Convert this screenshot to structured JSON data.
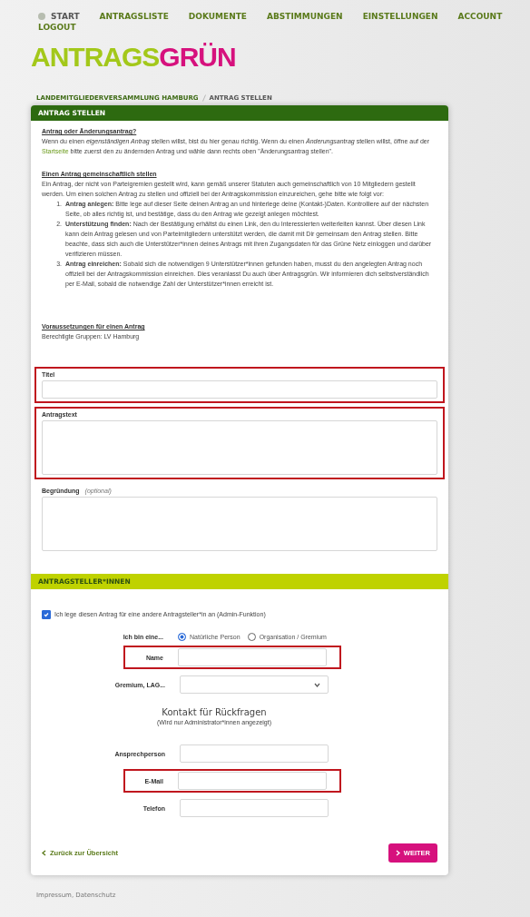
{
  "nav": [
    {
      "label": "START",
      "kind": "home"
    },
    {
      "label": "ANTRAGSLISTE",
      "kind": "link"
    },
    {
      "label": "DOKUMENTE",
      "kind": "link"
    },
    {
      "label": "ABSTIMMUNGEN",
      "kind": "link"
    },
    {
      "label": "EINSTELLUNGEN",
      "kind": "link"
    },
    {
      "label": "ACCOUNT",
      "kind": "link"
    },
    {
      "label": "LOGOUT",
      "kind": "link"
    }
  ],
  "logo": {
    "part_1": "ANTRAGS",
    "part_2": "GRÜN"
  },
  "breadcrumb": [
    "LANDEMITGLIEDERVERSAMMLUNG HAMBURG",
    "ANTRAG STELLEN"
  ],
  "card": {
    "title": "ANTRAG STELLEN",
    "intro": [
      {
        "heading": "Antrag oder Änderungsantrag?",
        "parts": [
          {
            "kind": "text",
            "text": "Wenn du einen *eigenständigen Antrag* stellen willst, bist du hier genau richtig. Wenn du einen *Änderungsantrag* stellen willst, öffne auf der "
          },
          {
            "kind": "link",
            "text": "Startseite"
          },
          {
            "kind": "text",
            "text": " bitte zuerst den zu ändernden Antrag und wähle dann rechts oben \"Änderungsantrag stellen\"."
          }
        ]
      },
      {
        "heading": "Einen Antrag gemeinschaftlich stellen",
        "parts": [
          {
            "kind": "text",
            "text": "Ein Antrag, der nicht von Parteigremien gestellt wird, kann gemäß unserer Statuten auch gemeinschaftlich von 10 Mitgliedern gestellt werden. Um einen solchen Antrag zu stellen und offiziell bei der Antragskommission einzureichen, gehe bitte wie folgt vor:"
          }
        ],
        "steps": [
          {
            "number": "1.",
            "text": "**Antrag anlegen:** Bitte lege auf dieser Seite deinen Antrag an und hinterlege deine (Kontakt-)Daten. Kontrolliere auf der nächsten Seite, ob alles richtig ist, und bestätige, dass du den Antrag wie gezeigt anlegen möchtest."
          },
          {
            "number": "2.",
            "text": "**Unterstützung finden:** Nach der Bestätigung erhältst du einen Link, den du Interessierten weiterleiten kannst. Über diesen Link kann dein Antrag gelesen und von Parteimitgliedern unterstützt werden, die damit mit Dir gemeinsam den Antrag stellen. Bitte beachte, dass sich auch die Unterstützer*innen deines Antrags mit ihren Zugangsdaten für das Grüne Netz einloggen und darüber verifizieren müssen."
          },
          {
            "number": "3.",
            "text": "**Antrag einreichen:** Sobald sich die notwendigen 9 Unterstützer*innen gefunden haben, musst du den angelegten Antrag noch offiziell bei der Antragskommission einreichen. Dies veranlasst Du auch über Antragsgrün. Wir informieren dich selbstverständlich per E-Mail, sobald die notwendige Zahl der Unterstützer*innen erreicht ist."
          }
        ]
      }
    ],
    "requirements": {
      "heading": "Voraussetzungen für einen Antrag",
      "text": "Berechtigte Gruppen: LV Hamburg"
    },
    "fields": [
      {
        "label": "Titel",
        "kind": "input",
        "highlighted": true
      },
      {
        "label": "Antragstext",
        "kind": "textarea",
        "highlighted": true
      },
      {
        "label": "Begründung",
        "hint": "(optional)",
        "kind": "textarea",
        "highlighted": false
      }
    ],
    "section": {
      "title": "ANTRAGSTELLER*INNEN",
      "admin_checkbox": {
        "label": "Ich lege diesen Antrag für eine andere Antragsteller*in an",
        "hint": "(Admin-Funktion)",
        "checked": true
      },
      "person_type": {
        "label": "Ich bin eine...",
        "options": [
          {
            "label": "Natürliche Person",
            "selected": true
          },
          {
            "label": "Organisation / Gremium",
            "selected": false
          }
        ]
      },
      "rows": [
        {
          "label": "Name",
          "kind": "input",
          "highlighted": true
        },
        {
          "label": "Gremium, LAG...",
          "kind": "select",
          "highlighted": false
        }
      ],
      "contact_heading": "Kontakt für Rückfragen",
      "contact_note": "(Wird nur Administrator*innen angezeigt)",
      "contact_rows": [
        {
          "label": "Ansprechperson",
          "kind": "input",
          "highlighted": false
        },
        {
          "label": "E-Mail",
          "kind": "input",
          "highlighted": true
        },
        {
          "label": "Telefon",
          "kind": "input",
          "highlighted": false
        }
      ]
    },
    "back_link": "Zurück zur Übersicht",
    "next_button": "WEITER"
  },
  "footer": "Impressum, Datenschutz"
}
